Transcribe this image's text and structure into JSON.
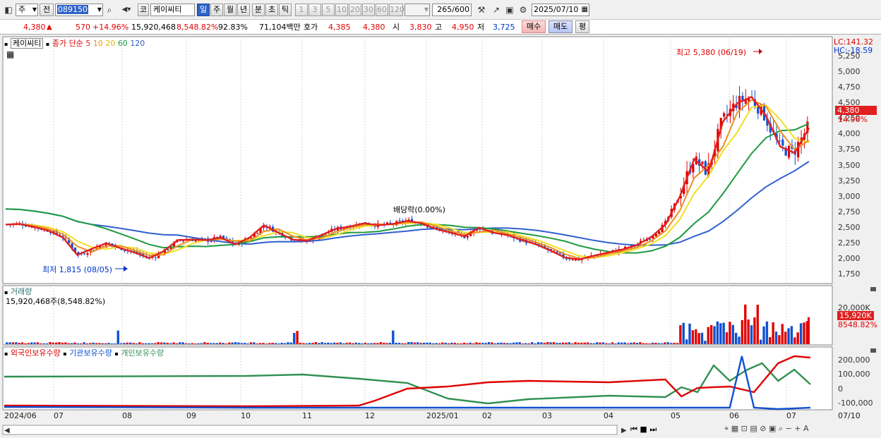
{
  "toolbar": {
    "market": "주",
    "prev": "전",
    "code": "089150",
    "market_type": "코",
    "stock_name": "케이씨티",
    "periods": [
      "일",
      "주",
      "월",
      "년",
      "분",
      "초",
      "틱"
    ],
    "active_period": "일",
    "intervals": [
      "1",
      "3",
      "5",
      "10",
      "20",
      "30",
      "60",
      "120"
    ],
    "count": "265",
    "count_max": "/600",
    "date": "2025/07/10"
  },
  "quote": {
    "price": "4,380",
    "arrow": "▲",
    "change": "570",
    "change_pct": "+14.96%",
    "volume": "15,920,468",
    "volume_pct": "8,548.82%",
    "turnover": "92.83%",
    "amount": "71,104백만",
    "bid_label": "호가",
    "bid": "4,385",
    "ask": "4,380",
    "open_label": "시",
    "open": "3,830",
    "high_label": "고",
    "high": "4,950",
    "low_label": "저",
    "low": "3,725",
    "buy": "매수",
    "sell": "매도",
    "eval": "평"
  },
  "price_panel": {
    "stock_name": "케이씨티",
    "ma_title": "종가 단순",
    "ma": [
      {
        "label": "5",
        "color": "#e02020"
      },
      {
        "label": "10",
        "color": "#f09020"
      },
      {
        "label": "20",
        "color": "#f0e020"
      },
      {
        "label": "60",
        "color": "#1e9a40"
      },
      {
        "label": "120",
        "color": "#3060d0"
      }
    ],
    "lc": "LC:141.32",
    "hc": "HC:-18.59",
    "last_price": "4,380",
    "last_pct": "14.96%",
    "high_note": "최고 5,380 (06/19)",
    "low_note": "최저 1,815 (08/05)",
    "dividend_note": "배당락(0.00%)",
    "yticks": [
      "5,250",
      "5,000",
      "4,750",
      "4,500",
      "4,250",
      "4,000",
      "3,750",
      "3,500",
      "3,250",
      "3,000",
      "2,750",
      "2,500",
      "2,250",
      "2,000",
      "1,750"
    ]
  },
  "volume_panel": {
    "title": "거래량",
    "value": "15,920,468주(8,548.82%)",
    "ytick": "20,000K",
    "last": "15,920K",
    "last_pct": "8548.82%"
  },
  "holding_panel": {
    "series": [
      {
        "name": "외국인보유수량",
        "color": "#e00000"
      },
      {
        "name": "기관보유수량",
        "color": "#1050d0"
      },
      {
        "name": "개인보유수량",
        "color": "#309050"
      }
    ],
    "yticks": [
      "200,000",
      "100,000",
      "0",
      "-100,000"
    ]
  },
  "xaxis": [
    "2024/06",
    "07",
    "08",
    "09",
    "10",
    "11",
    "12",
    "2025/01",
    "02",
    "03",
    "04",
    "05",
    "06",
    "07"
  ],
  "xaxis_end": "07/10",
  "chart_data": {
    "type": "candlestick",
    "ylim": [
      1750,
      5250
    ],
    "series": [
      {
        "name": "5",
        "values": [
          2550,
          2560,
          2510,
          2450,
          2340,
          2060,
          2160,
          2250,
          2170,
          2100,
          2010,
          2120,
          2300,
          2310,
          2300,
          2340,
          2230,
          2340,
          2540,
          2420,
          2310,
          2290,
          2380,
          2480,
          2520,
          2570,
          2540,
          2560,
          2610,
          2570,
          2480,
          2420,
          2360,
          2500,
          2420,
          2380,
          2300,
          2230,
          2130,
          2020,
          1990,
          2050,
          2100,
          2150,
          2220,
          2350,
          2550,
          3000,
          3600,
          3400,
          4200,
          4500,
          4600,
          4300,
          3800,
          3700,
          4100
        ]
      }
    ],
    "volume_k": {
      "last": 15920
    }
  }
}
